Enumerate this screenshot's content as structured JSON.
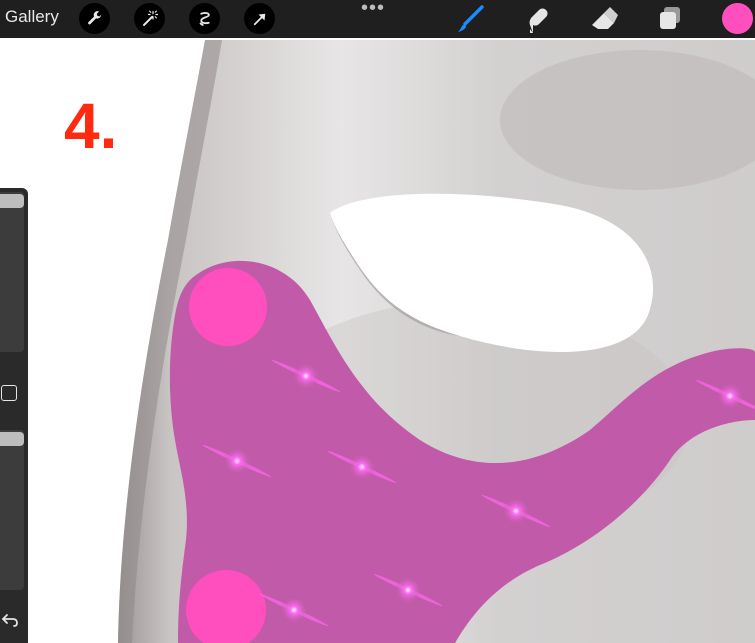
{
  "topbar": {
    "gallery_label": "Gallery",
    "left_tools": [
      {
        "name": "wrench-icon"
      },
      {
        "name": "magic-wand-icon"
      },
      {
        "name": "selection-icon"
      },
      {
        "name": "transform-arrow-icon"
      }
    ],
    "more_label": "•••",
    "right_tools": [
      {
        "name": "brush-icon",
        "color": "#1a8cff"
      },
      {
        "name": "smudge-icon",
        "color": "#e6e6e6"
      },
      {
        "name": "eraser-icon",
        "color": "#e6e6e6"
      },
      {
        "name": "layers-icon",
        "color": "#e6e6e6"
      }
    ],
    "current_color": "#ff4fbf"
  },
  "canvas": {
    "step_label": "4.",
    "step_color": "#ff2a10",
    "blush_color": "#c15aa8",
    "dot_color": "#ff4fbf",
    "sparkle_color": "#ff5cf4"
  },
  "sidebar": {
    "modify_icon": "square-modify-icon",
    "undo_icon": "undo-icon"
  }
}
